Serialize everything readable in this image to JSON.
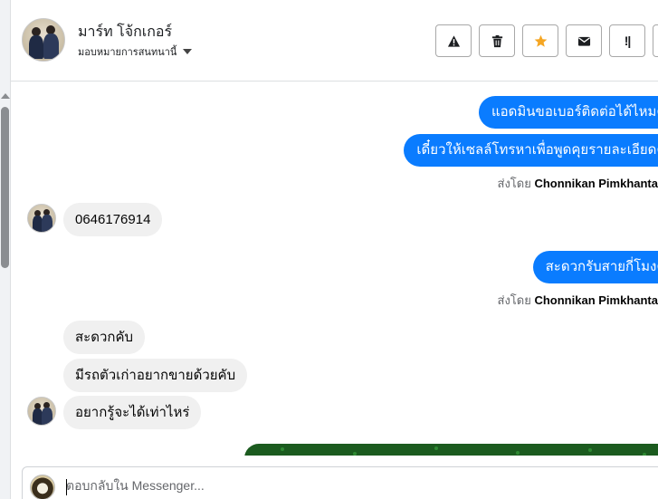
{
  "header": {
    "contact_name": "มาร์ท โจ้กเกอร์",
    "assign_label": "มอบหมายการสนทนานี้",
    "actions": [
      {
        "name": "spam",
        "icon": "warning-icon",
        "label": ""
      },
      {
        "name": "delete",
        "icon": "trash-icon",
        "label": ""
      },
      {
        "name": "follow-up",
        "icon": "star-icon",
        "label": "",
        "color": "#f5a623"
      },
      {
        "name": "unread",
        "icon": "envelope-icon",
        "label": ""
      },
      {
        "name": "priority",
        "icon": "priority-icon",
        "label": "!|"
      }
    ]
  },
  "messages": {
    "out_1": "แอดมินขอเบอร์ติดต่อได้ไหมครับ",
    "out_2": "เดี๋ยวให้เซลล์โทรหาเพื่อพูดคุยรายละเอียดครับ",
    "sent_by_prefix": "ส่งโดย",
    "sent_by_name": "Chonnikan Pimkhanta",
    "in_1": "0646176914",
    "out_3": "สะดวกรับสายกี่โมงครับ",
    "in_2": "สะดวกคับ",
    "in_3": "มีรถตัวเก่าอยากขายด้วยคับ",
    "in_4": "อยากรู้จะได้เท่าไหร่"
  },
  "composer": {
    "value": "",
    "placeholder": "ตอบกลับใน Messenger..."
  },
  "colors": {
    "outgoing_bubble": "#0a7cff",
    "incoming_bubble": "#f0f0f0",
    "star": "#f5a623"
  }
}
